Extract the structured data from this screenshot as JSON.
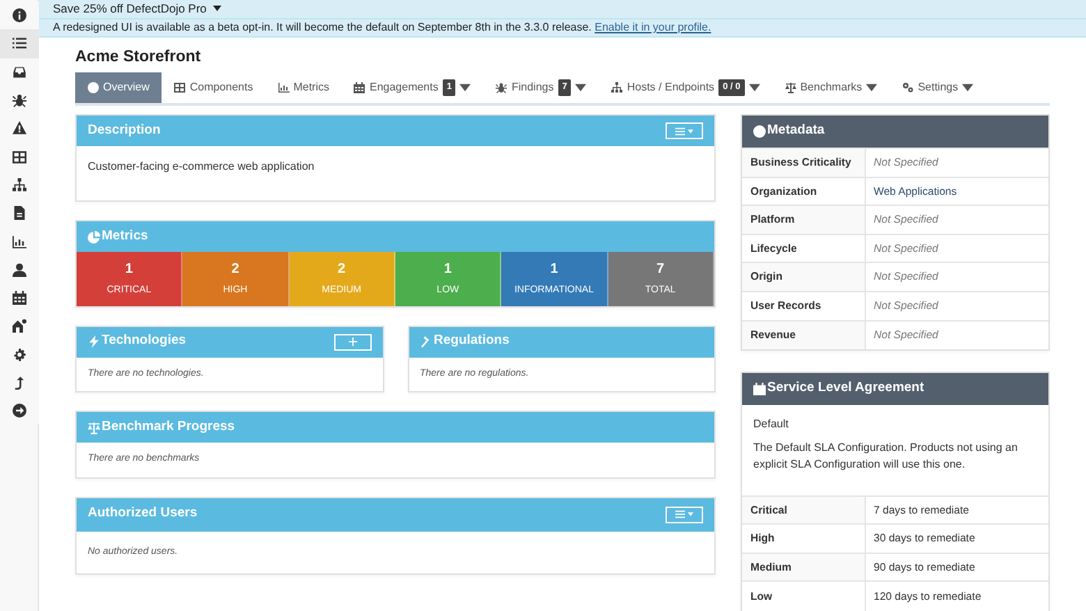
{
  "sidebar": {
    "items": [
      {
        "selected": false
      },
      {
        "selected": true
      },
      {
        "selected": false
      },
      {
        "selected": false
      },
      {
        "selected": false
      },
      {
        "selected": false
      },
      {
        "selected": false
      },
      {
        "selected": false
      },
      {
        "selected": false
      },
      {
        "selected": false
      },
      {
        "selected": false
      },
      {
        "selected": false
      },
      {
        "selected": false
      },
      {
        "selected": false
      },
      {
        "selected": false
      }
    ]
  },
  "banner": {
    "text": "Save 25% off DefectDojo Pro"
  },
  "notice": {
    "text": "A redesigned UI is available as a beta opt-in. It will become the default on September 8th in the 3.3.0 release.",
    "link": "Enable it in your profile."
  },
  "product": {
    "title": "Acme Storefront"
  },
  "tabs": [
    {
      "label": "Overview",
      "selected": true,
      "dropdown": false
    },
    {
      "label": "Components",
      "selected": false,
      "dropdown": false
    },
    {
      "label": "Metrics",
      "selected": false,
      "dropdown": false
    },
    {
      "label": "Engagements",
      "badge": "1",
      "selected": false,
      "dropdown": true
    },
    {
      "label": "Findings",
      "badge": "7",
      "selected": false,
      "dropdown": true
    },
    {
      "label": "Hosts / Endpoints",
      "badge": "0 / 0",
      "selected": false,
      "dropdown": true
    },
    {
      "label": "Benchmarks",
      "selected": false,
      "dropdown": true
    },
    {
      "label": "Settings",
      "selected": false,
      "dropdown": true
    }
  ],
  "description": {
    "title": "Description",
    "text": "Customer-facing e-commerce web application"
  },
  "metrics": {
    "title": "Metrics",
    "tiles": [
      {
        "count": "1",
        "label": "CRITICAL",
        "color": "#d43f3a"
      },
      {
        "count": "2",
        "label": "HIGH",
        "color": "#d8771f"
      },
      {
        "count": "2",
        "label": "MEDIUM",
        "color": "#e4a91b"
      },
      {
        "count": "1",
        "label": "LOW",
        "color": "#4cae4c"
      },
      {
        "count": "1",
        "label": "INFORMATIONAL",
        "color": "#337ab7"
      },
      {
        "count": "7",
        "label": "TOTAL",
        "color": "#777777"
      }
    ]
  },
  "technologies": {
    "title": "Technologies",
    "empty_text": "There are no technologies."
  },
  "regulations": {
    "title": "Regulations",
    "empty_text": "There are no regulations."
  },
  "benchmark_progress": {
    "title": "Benchmark Progress",
    "empty_text": "There are no benchmarks"
  },
  "authorized_users": {
    "title": "Authorized Users",
    "empty_text": "No authorized users."
  },
  "metadata": {
    "title": "Metadata",
    "rows": [
      {
        "label": "Business Criticality",
        "value": "Not Specified",
        "specified": false
      },
      {
        "label": "Organization",
        "value": "Web Applications",
        "specified": true
      },
      {
        "label": "Platform",
        "value": "Not Specified",
        "specified": false
      },
      {
        "label": "Lifecycle",
        "value": "Not Specified",
        "specified": false
      },
      {
        "label": "Origin",
        "value": "Not Specified",
        "specified": false
      },
      {
        "label": "User Records",
        "value": "Not Specified",
        "specified": false
      },
      {
        "label": "Revenue",
        "value": "Not Specified",
        "specified": false
      }
    ]
  },
  "sla": {
    "title": "Service Level Agreement",
    "name": "Default",
    "description": "The Default SLA Configuration. Products not using an explicit SLA Configuration will use this one.",
    "rows": [
      {
        "severity": "Critical",
        "days": "7 days to remediate"
      },
      {
        "severity": "High",
        "days": "30 days to remediate"
      },
      {
        "severity": "Medium",
        "days": "90 days to remediate"
      },
      {
        "severity": "Low",
        "days": "120 days to remediate"
      }
    ]
  }
}
